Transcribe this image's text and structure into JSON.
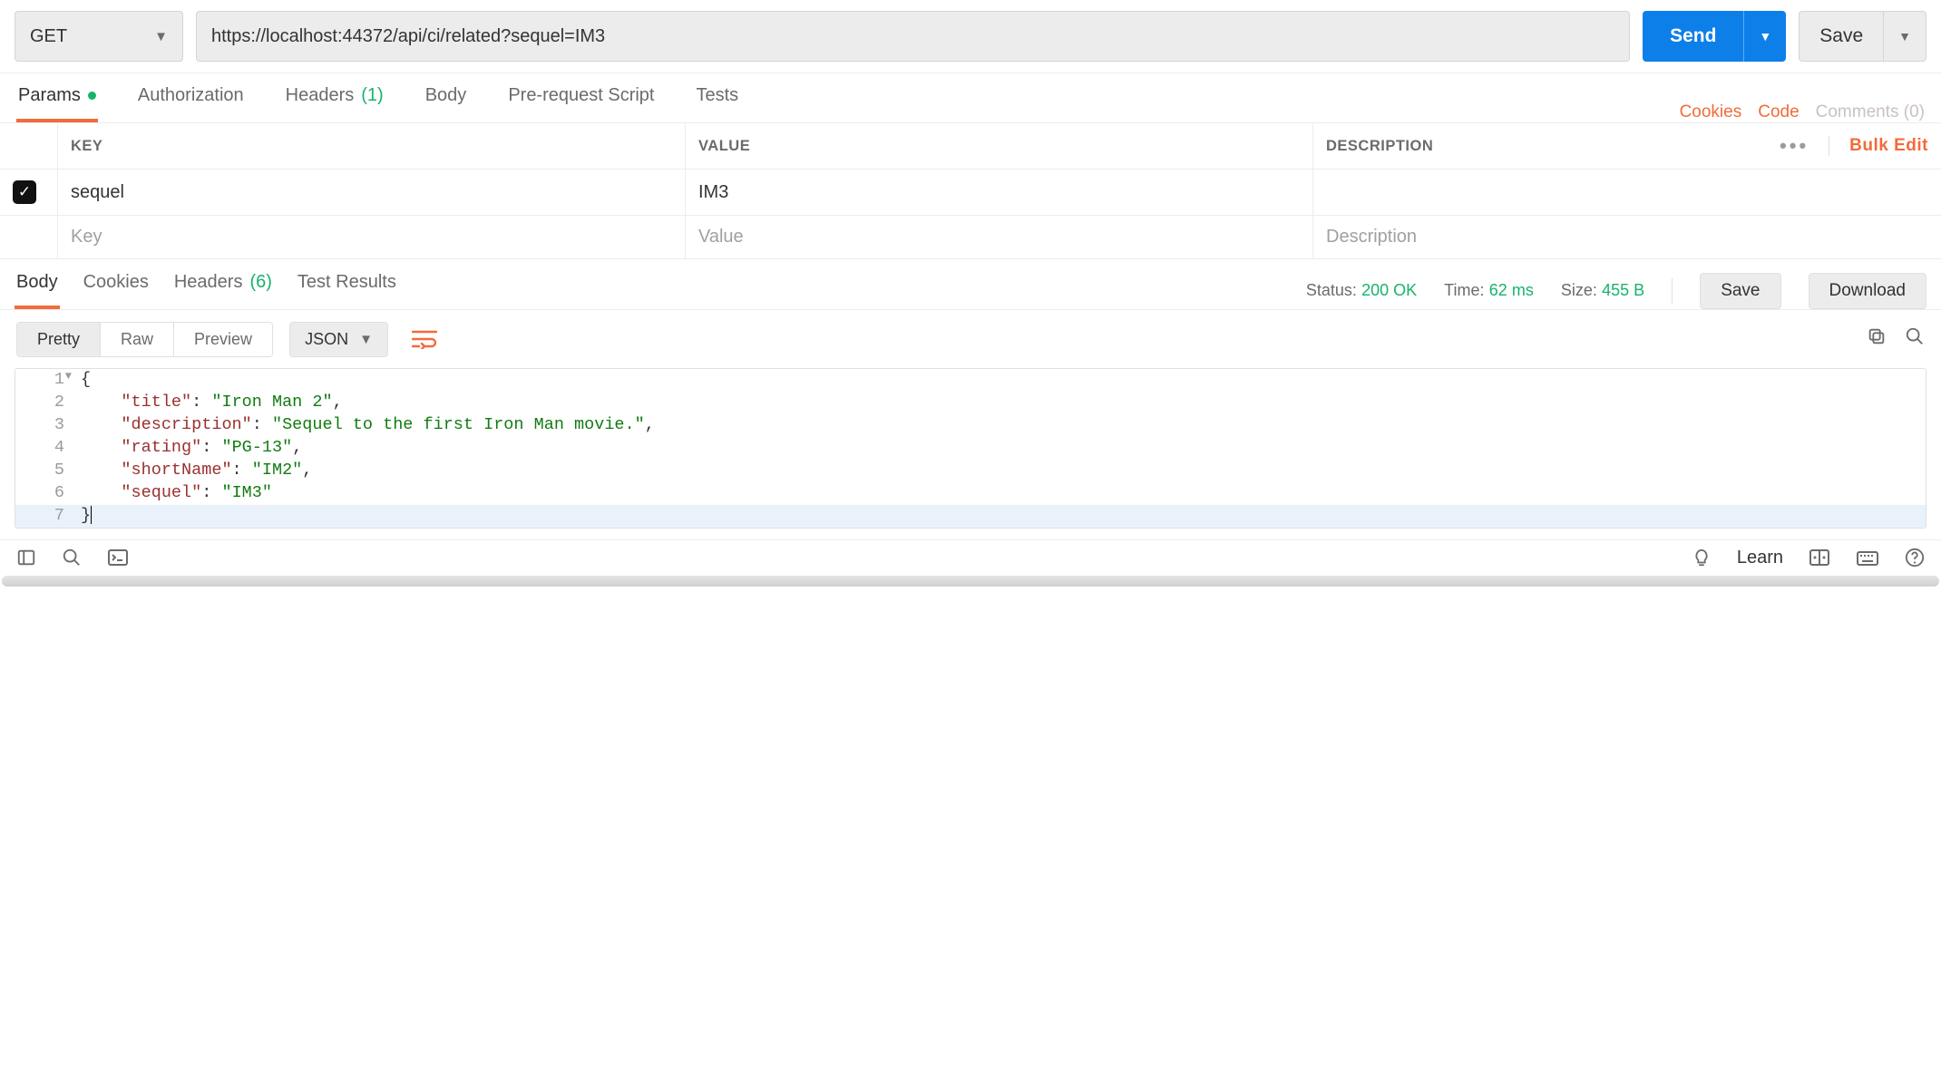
{
  "request": {
    "method": "GET",
    "url": "https://localhost:44372/api/ci/related?sequel=IM3",
    "send_label": "Send",
    "save_label": "Save"
  },
  "request_tabs": {
    "params": "Params",
    "authorization": "Authorization",
    "headers_label": "Headers",
    "headers_count": "(1)",
    "body": "Body",
    "prerequest": "Pre-request Script",
    "tests": "Tests"
  },
  "request_links": {
    "cookies": "Cookies",
    "code": "Code",
    "comments": "Comments (0)"
  },
  "params_grid": {
    "headers": {
      "key": "KEY",
      "value": "VALUE",
      "description": "DESCRIPTION"
    },
    "bulk_edit": "Bulk Edit",
    "rows": [
      {
        "enabled": true,
        "key": "sequel",
        "value": "IM3",
        "description": ""
      }
    ],
    "placeholders": {
      "key": "Key",
      "value": "Value",
      "description": "Description"
    }
  },
  "response_tabs": {
    "body": "Body",
    "cookies": "Cookies",
    "headers_label": "Headers",
    "headers_count": "(6)",
    "test_results": "Test Results"
  },
  "response_meta": {
    "status_label": "Status:",
    "status_value": "200 OK",
    "time_label": "Time:",
    "time_value": "62 ms",
    "size_label": "Size:",
    "size_value": "455 B",
    "save_btn": "Save",
    "download_btn": "Download"
  },
  "view": {
    "pretty": "Pretty",
    "raw": "Raw",
    "preview": "Preview",
    "format": "JSON"
  },
  "response_body": {
    "title": "Iron Man 2",
    "description": "Sequel to the first Iron Man movie.",
    "rating": "PG-13",
    "shortName": "IM2",
    "sequel": "IM3"
  },
  "footer": {
    "learn": "Learn"
  }
}
